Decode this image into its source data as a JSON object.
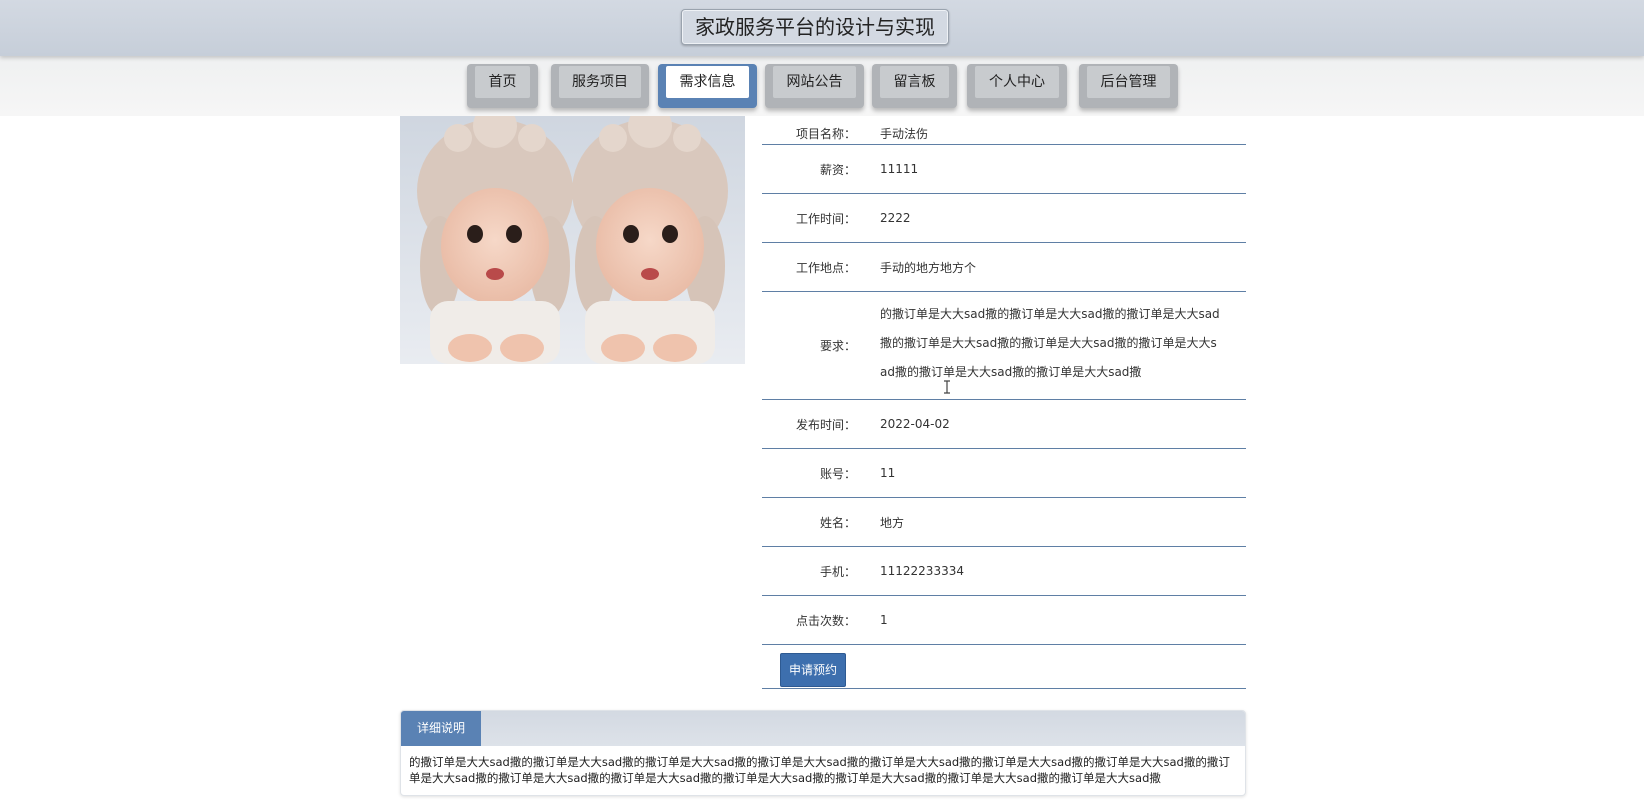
{
  "header": {
    "title": "家政服务平台的设计与实现"
  },
  "nav": {
    "items": [
      {
        "label": "首页"
      },
      {
        "label": "服务项目"
      },
      {
        "label": "需求信息"
      },
      {
        "label": "网站公告"
      },
      {
        "label": "留言板"
      },
      {
        "label": "个人中心"
      },
      {
        "label": "后台管理"
      }
    ],
    "active": "需求信息"
  },
  "detail": {
    "rows": [
      {
        "label": "项目名称：",
        "value": "手动法伤"
      },
      {
        "label": "薪资：",
        "value": "11111"
      },
      {
        "label": "工作时间：",
        "value": "2222"
      },
      {
        "label": "工作地点：",
        "value": "手动的地方地方个"
      },
      {
        "label": "要求：",
        "value": "的撒订单是大大sad撒的撒订单是大大sad撒的撒订单是大大sad撒的撒订单是大大sad撒的撒订单是大大sad撒的撒订单是大大sad撒的撒订单是大大sad撒的撒订单是大大sad撒"
      },
      {
        "label": "发布时间：",
        "value": "2022-04-02"
      },
      {
        "label": "账号：",
        "value": "11"
      },
      {
        "label": "姓名：",
        "value": "地方"
      },
      {
        "label": "手机：",
        "value": "11122233334"
      },
      {
        "label": "点击次数：",
        "value": "1"
      }
    ],
    "apply_label": "申请预约"
  },
  "description": {
    "tab_label": "详细说明",
    "text": "的撒订单是大大sad撒的撒订单是大大sad撒的撒订单是大大sad撒的撒订单是大大sad撒的撒订单是大大sad撒的撒订单是大大sad撒的撒订单是大大sad撒的撒订单是大大sad撒的撒订单是大大sad撒的撒订单是大大sad撒的撒订单是大大sad撒的撒订单是大大sad撒的撒订单是大大sad撒的撒订单是大大sad撒"
  },
  "colors": {
    "accent": "#5a82b4",
    "button": "#3d6fae",
    "divider": "#5f7fa5",
    "header_bg": "#d3d9e2"
  }
}
